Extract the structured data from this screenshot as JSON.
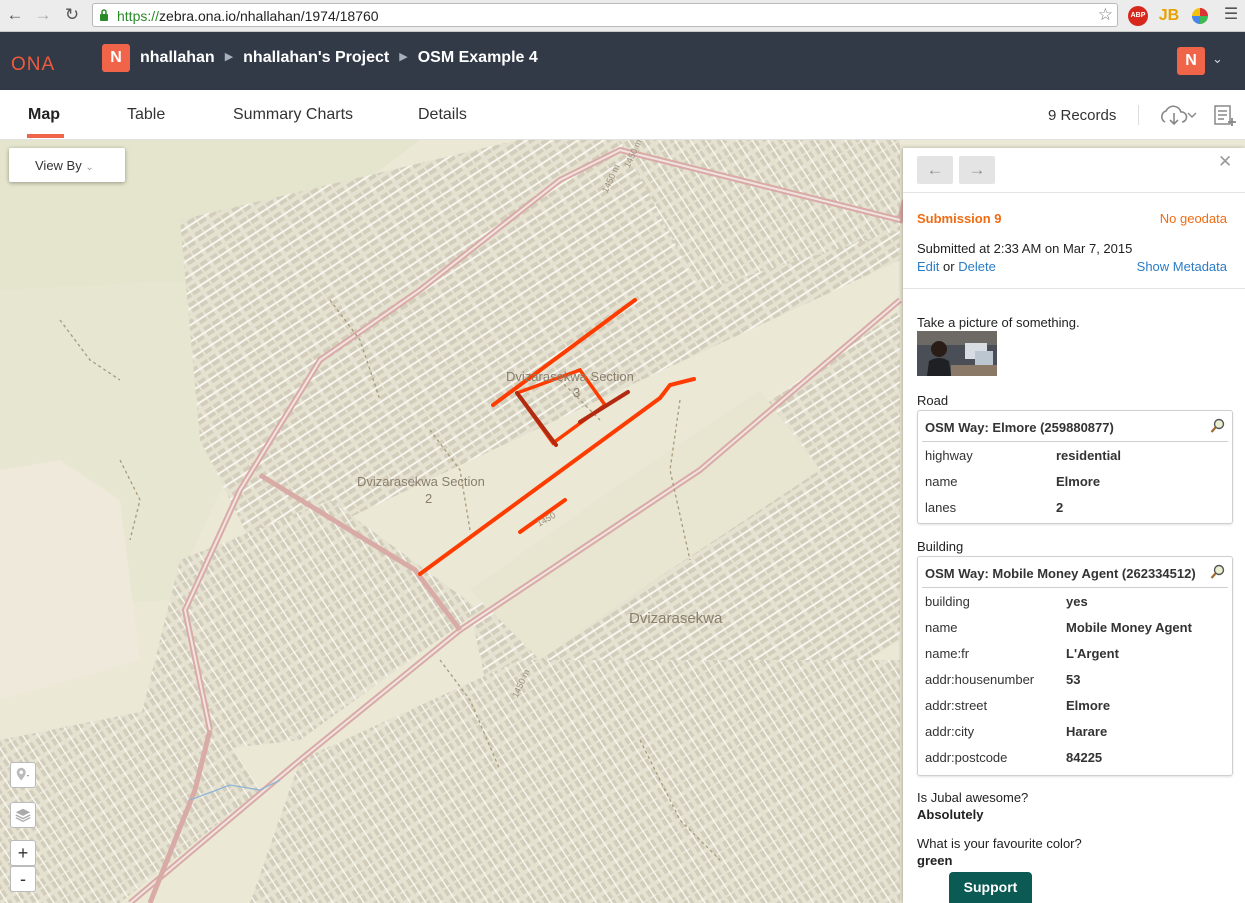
{
  "browser": {
    "url_protocol": "https://",
    "url_host_path": "zebra.ona.io/nhallahan/1974/18760",
    "ext_abp": "ABP",
    "ext_jb": "JB"
  },
  "header": {
    "logo": "ONA",
    "user_initial": "N",
    "breadcrumbs": [
      "nhallahan",
      "nhallahan's Project",
      "OSM Example 4"
    ]
  },
  "tabs": [
    {
      "label": "Map",
      "active": true
    },
    {
      "label": "Table",
      "active": false
    },
    {
      "label": "Summary Charts",
      "active": false
    },
    {
      "label": "Details",
      "active": false
    }
  ],
  "records_label": "9 Records",
  "map": {
    "view_by_label": "View By",
    "zoom_in": "+",
    "zoom_out": "-",
    "labels": {
      "section3_line1": "Dvizarasekwa Section",
      "section3_line2": "3",
      "section2_line1": "Dvizarasekwa Section",
      "section2_line2": "2",
      "area": "Dvizarasekwa",
      "contour_a": "1450 m",
      "contour_b": "1450 m",
      "contour_c": "1450 m",
      "contour_d": "1450"
    },
    "colors": {
      "road_highlight": "#ff3c00",
      "road_dark": "#b22b10",
      "main_road": "#d9aba6"
    }
  },
  "submission": {
    "title": "Submission 9",
    "geodata_status": "No geodata",
    "submitted_text": "Submitted at 2:33 AM on Mar 7, 2015",
    "edit_label": "Edit",
    "or_label": "or",
    "delete_label": "Delete",
    "show_metadata_label": "Show Metadata",
    "picture_question": "Take a picture of something.",
    "road_label": "Road",
    "road": {
      "title": "OSM Way: Elmore (259880877)",
      "tags": [
        {
          "key": "highway",
          "value": "residential"
        },
        {
          "key": "name",
          "value": "Elmore"
        },
        {
          "key": "lanes",
          "value": "2"
        }
      ]
    },
    "building_label": "Building",
    "building": {
      "title": "OSM Way: Mobile Money Agent (262334512)",
      "tags": [
        {
          "key": "building",
          "value": "yes"
        },
        {
          "key": "name",
          "value": "Mobile Money Agent"
        },
        {
          "key": "name:fr",
          "value": "L'Argent"
        },
        {
          "key": "addr:housenumber",
          "value": "53"
        },
        {
          "key": "addr:street",
          "value": "Elmore"
        },
        {
          "key": "addr:city",
          "value": "Harare"
        },
        {
          "key": "addr:postcode",
          "value": "84225"
        }
      ]
    },
    "q_awesome": "Is Jubal awesome?",
    "a_awesome": "Absolutely",
    "q_color": "What is your favourite color?",
    "a_color": "green"
  },
  "support_label": "Support"
}
